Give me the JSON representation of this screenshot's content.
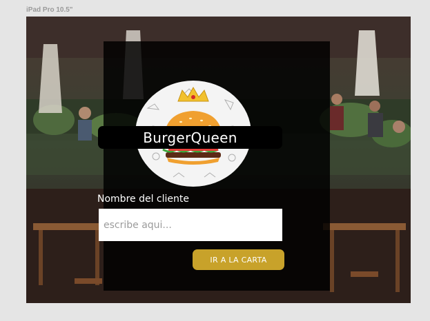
{
  "device": {
    "label": "iPad Pro 10.5\""
  },
  "brand": {
    "name": "BurgerQueen",
    "logo_icon": "burger-logo-icon"
  },
  "form": {
    "label": "Nombre del cliente",
    "placeholder": "escribe aqui...",
    "value": ""
  },
  "actions": {
    "go_to_menu": "IR A LA CARTA"
  },
  "colors": {
    "page_background": "#e5e5e5",
    "panel_overlay": "#000000",
    "button_gold": "#c8a22a",
    "input_background": "#ffffff",
    "text_light": "#ffffff"
  }
}
